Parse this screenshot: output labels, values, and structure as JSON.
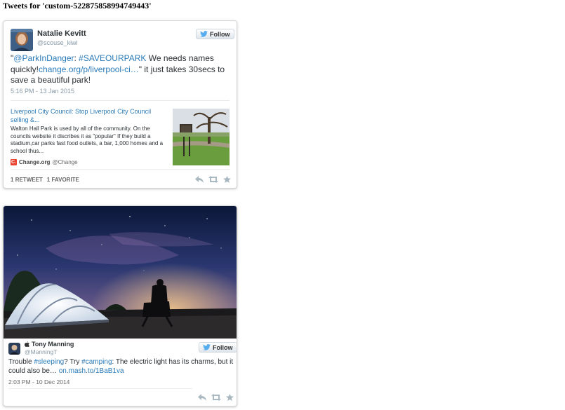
{
  "page": {
    "title": "Tweets for 'custom-522875858994749443'"
  },
  "tweets": [
    {
      "author": {
        "name": "Natalie Kevitt",
        "handle": "@scouse_kiwi"
      },
      "follow_label": "Follow",
      "text": {
        "q_open": "\"",
        "mention": "@ParkInDanger",
        "colon": ": ",
        "hashtag": "#SAVEOURPARK",
        "mid": "  We needs names quickly!",
        "link": "change.org/p/liverpool-ci…",
        "tail": "\" it just takes 30secs to save a beautiful park!"
      },
      "timestamp": "5:16 PM - 13 Jan 2015",
      "card": {
        "title": "Liverpool City Council: Stop Liverpool City Council selling &...",
        "description": "Walton Hall Park is used by all of the community. On the councils website it discribes it as \"popular\" If they build a stadium,car parks fast food outlets, a bar, 1,000 homes and a school thus...",
        "logo_letter": "C.",
        "source_name": "Change.org",
        "source_handle": "@Change"
      },
      "retweets_count": "1",
      "retweets_label": "RETWEET",
      "favorites_count": "1",
      "favorites_label": "FAVORITE",
      "icons": [
        "reply-icon",
        "retweet-icon",
        "favorite-icon"
      ]
    },
    {
      "author": {
        "name": "Tony Manning",
        "handle": "@ManningT"
      },
      "follow_label": "Follow",
      "text": {
        "a": "Trouble ",
        "hashtag1": "#sleeping",
        "b": "? Try ",
        "hashtag2": "#camping",
        "c": ": The electric light has its charms, but it could also be… ",
        "link": "on.mash.to/1BaB1va"
      },
      "timestamp": "2:03 PM - 10 Dec 2014",
      "icons": [
        "apple-icon",
        "reply-icon",
        "retweet-icon",
        "favorite-icon"
      ]
    }
  ],
  "colors": {
    "link": "#2b7bb9",
    "muted": "#8899a6",
    "text": "#292f33",
    "twitter_blue": "#55acee",
    "change_red": "#e8412f"
  }
}
